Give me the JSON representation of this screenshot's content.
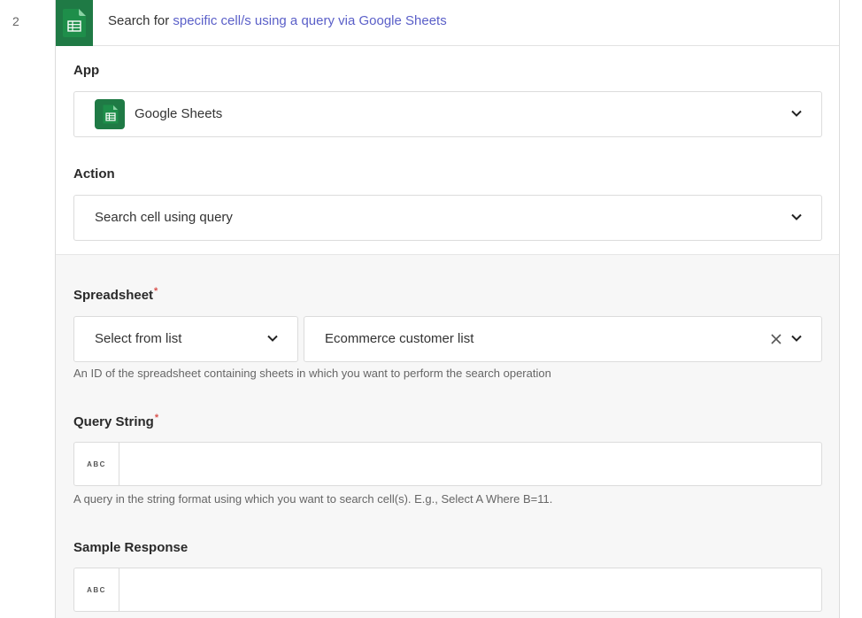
{
  "step": {
    "number": "2",
    "title_prefix": "Search for ",
    "title_link": "specific cell/s using a query via Google Sheets"
  },
  "app_field": {
    "label": "App",
    "value": "Google Sheets",
    "icon": "google-sheets-icon"
  },
  "action_field": {
    "label": "Action",
    "value": "Search cell using query"
  },
  "spreadsheet_field": {
    "label": "Spreadsheet",
    "required_mark": "*",
    "mode_value": "Select from list",
    "value": "Ecommerce customer list",
    "help": "An ID of the spreadsheet containing sheets in which you want to perform the search operation"
  },
  "query_field": {
    "label": "Query String",
    "required_mark": "*",
    "type_badge": "ABC",
    "value": "",
    "help": "A query in the string format using which you want to search cell(s). E.g., Select A Where B=11."
  },
  "sample_field": {
    "label": "Sample Response",
    "type_badge": "ABC",
    "value": ""
  },
  "colors": {
    "sheets_green": "#1f7a45",
    "link_purple": "#5a5fc8",
    "required_red": "#d9534f"
  }
}
